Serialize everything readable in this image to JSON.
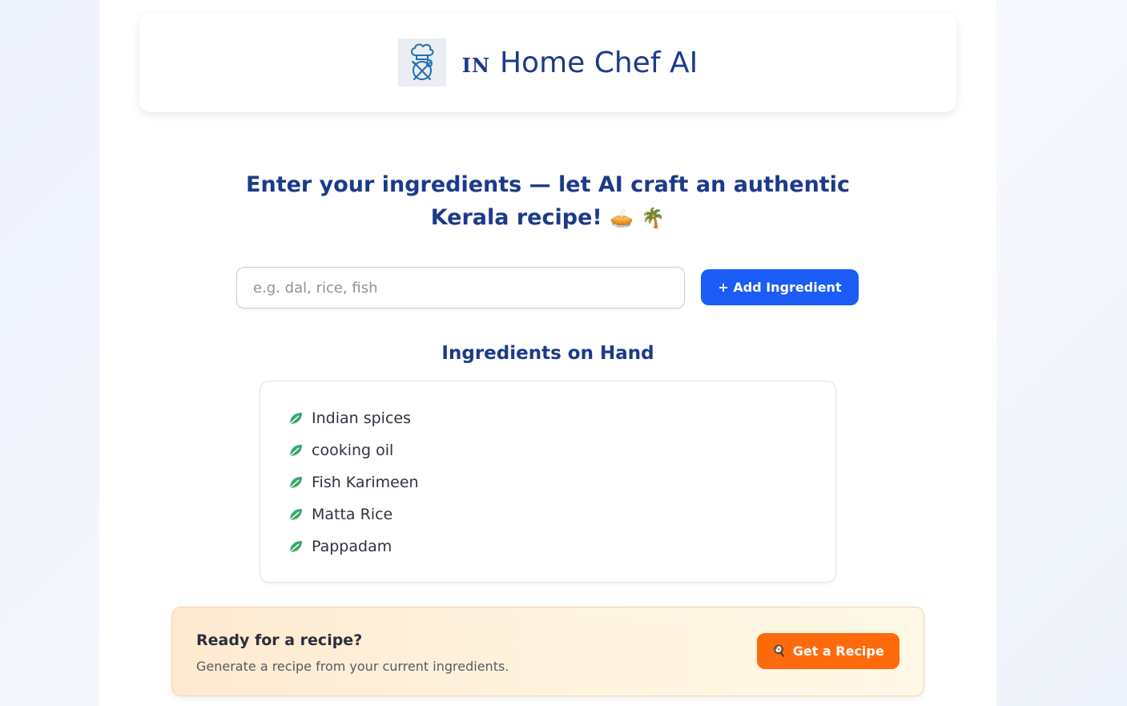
{
  "header": {
    "flag_code": "IN",
    "app_title": "Home Chef AI",
    "logo_icon": "chef-hat-fork-spoon-icon"
  },
  "hero": {
    "headline_line1": "Enter your ingredients — let AI craft an authentic",
    "headline_line2": "Kerala recipe!",
    "emoji_1": "🥧",
    "emoji_2": "🌴"
  },
  "input": {
    "placeholder": "e.g. dal, rice, fish",
    "value": "",
    "add_button_label": "+ Add Ingredient"
  },
  "ingredients": {
    "section_title": "Ingredients on Hand",
    "item_icon": "leaf-icon",
    "items": [
      {
        "label": "Indian spices"
      },
      {
        "label": "cooking oil"
      },
      {
        "label": "Fish Karimeen"
      },
      {
        "label": "Matta Rice"
      },
      {
        "label": "Pappadam"
      }
    ]
  },
  "recipe_banner": {
    "title": "Ready for a recipe?",
    "subtitle": "Generate a recipe from your current ingredients.",
    "button_icon": "🍳",
    "button_label": "Get a Recipe"
  },
  "colors": {
    "brand_blue": "#1b3a8a",
    "primary_button": "#1a5cf5",
    "accent_orange": "#ff6a0d",
    "leaf_green": "#3aa86b"
  }
}
